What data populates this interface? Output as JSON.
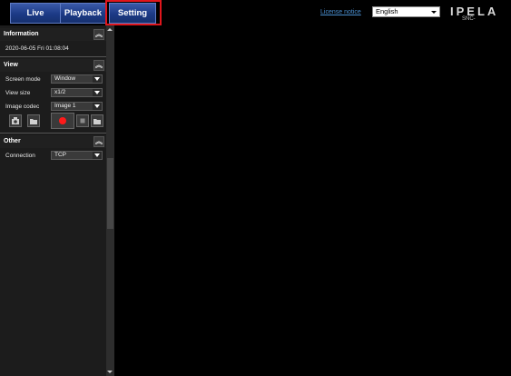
{
  "tabs": {
    "live": "Live",
    "playback": "Playback",
    "setting": "Setting"
  },
  "header": {
    "license_link": "License notice",
    "language": "English",
    "logo": "IPELA",
    "model": "SNC-"
  },
  "sections": {
    "information": {
      "title": "Information",
      "datetime": "2020-06-05 Fri 01:08:04"
    },
    "view": {
      "title": "View",
      "screen_mode_label": "Screen mode",
      "screen_mode_value": "Window",
      "view_size_label": "View size",
      "view_size_value": "x1/2",
      "image_codec_label": "Image codec",
      "image_codec_value": "Image 1"
    },
    "other": {
      "title": "Other",
      "connection_label": "Connection",
      "connection_value": "TCP"
    }
  },
  "colors": {
    "highlight": "#e0161c",
    "tab_blue": "#1c3a86",
    "record_red": "#ff1a1a"
  }
}
